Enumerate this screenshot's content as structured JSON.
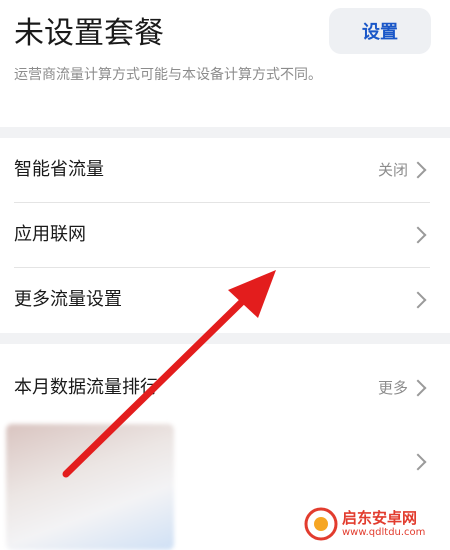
{
  "header": {
    "title": "未设置套餐",
    "setup_label": "设置",
    "note": "运营商流量计算方式可能与本设备计算方式不同。"
  },
  "settings": {
    "smart_saver": {
      "label": "智能省流量",
      "value": "关闭"
    },
    "app_networking": {
      "label": "应用联网"
    },
    "more_settings": {
      "label": "更多流量设置"
    }
  },
  "ranking": {
    "label": "本月数据流量排行",
    "more_label": "更多"
  },
  "watermark": {
    "name": "启东安卓网",
    "url": "www.qdltdu.com"
  },
  "colors": {
    "accent_blue": "#1a57c8",
    "annotation_arrow": "#e31d1d",
    "watermark_red": "#e23c2e"
  }
}
